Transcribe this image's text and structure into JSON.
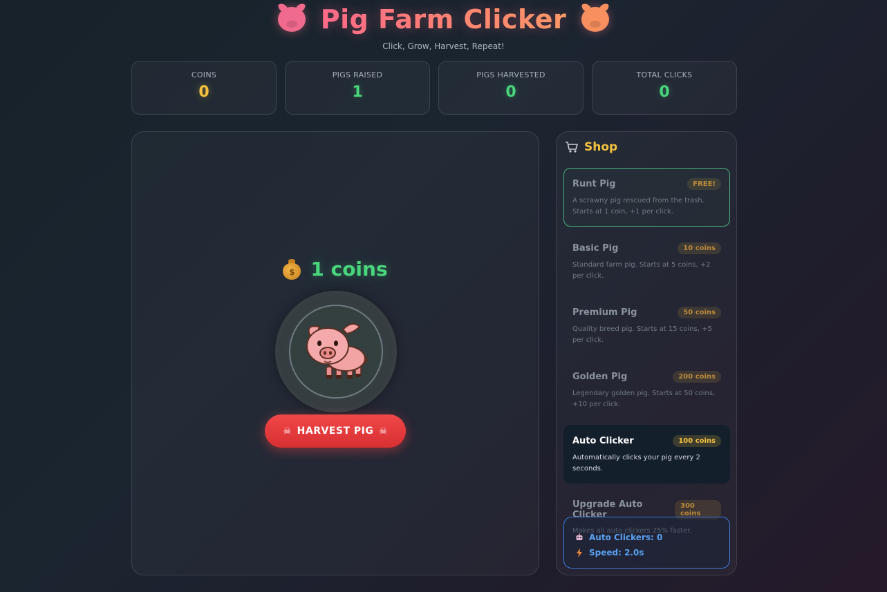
{
  "header": {
    "title": "Pig Farm Clicker",
    "subtitle": "Click, Grow, Harvest, Repeat!",
    "icons": [
      "pig-face-icon",
      "pig-face-icon"
    ]
  },
  "stats": [
    {
      "label": "COINS",
      "value": "0",
      "color": "#f6c23e"
    },
    {
      "label": "PIGS RAISED",
      "value": "1",
      "color": "#49d67c"
    },
    {
      "label": "PIGS HARVESTED",
      "value": "0",
      "color": "#49d67c"
    },
    {
      "label": "TOTAL CLICKS",
      "value": "0",
      "color": "#49d67c"
    }
  ],
  "game": {
    "pig_coins": "1 coins",
    "coin_icon": "money-bag-icon",
    "pig_icon": "pig-icon",
    "harvest_label": "HARVEST PIG",
    "harvest_icon": "skull-icon"
  },
  "shop": {
    "title": "Shop",
    "icon": "shopping-cart-icon",
    "items": [
      {
        "name": "Runt Pig",
        "price": "FREE!",
        "desc": "A scrawny pig rescued from the trash. Starts at 1 coin, +1 per click.",
        "state": "free"
      },
      {
        "name": "Basic Pig",
        "price": "10 coins",
        "desc": "Standard farm pig. Starts at 5 coins, +2 per click.",
        "state": "disabled"
      },
      {
        "name": "Premium Pig",
        "price": "50 coins",
        "desc": "Quality breed pig. Starts at 15 coins, +5 per click.",
        "state": "disabled"
      },
      {
        "name": "Golden Pig",
        "price": "200 coins",
        "desc": "Legendary golden pig. Starts at 50 coins, +10 per click.",
        "state": "disabled"
      },
      {
        "name": "Auto Clicker",
        "price": "100 coins",
        "desc": "Automatically clicks your pig every 2 seconds.",
        "state": "active"
      },
      {
        "name": "Upgrade Auto Clicker",
        "price": "300 coins",
        "desc": "Makes all auto clickers 25% faster.",
        "state": "disabled"
      }
    ],
    "auto": {
      "clickers_label": "Auto Clickers: 0",
      "speed_label": "Speed: 2.0s"
    }
  },
  "colors": {
    "gold": "#f6c23e",
    "green": "#49d67c",
    "red": "#e53e3e",
    "blue": "#5aa0f0"
  }
}
